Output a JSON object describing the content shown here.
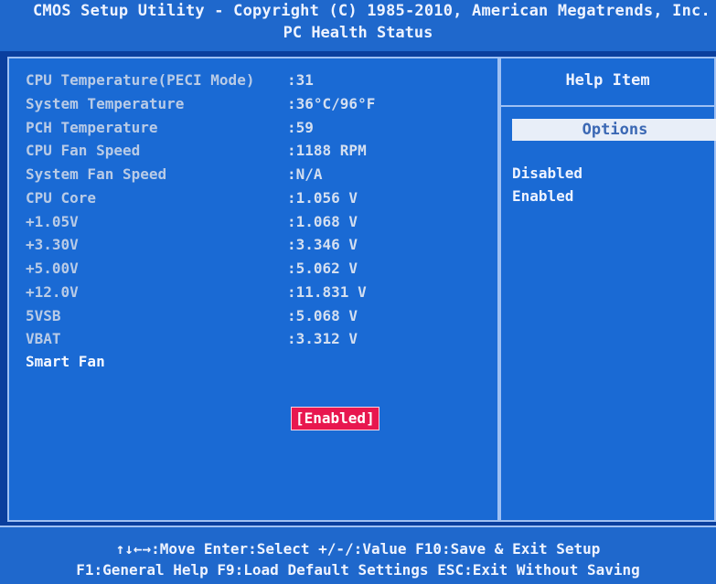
{
  "header": {
    "title": "CMOS Setup Utility - Copyright (C) 1985-2010, American Megatrends, Inc.",
    "subtitle": "PC Health Status"
  },
  "items": [
    {
      "label": "CPU Temperature(PECI Mode)",
      "value": ":31"
    },
    {
      "label": "System Temperature",
      "value": ":36°C/96°F"
    },
    {
      "label": "PCH Temperature",
      "value": ":59"
    },
    {
      "label": "CPU Fan Speed",
      "value": ":1188 RPM"
    },
    {
      "label": "System Fan Speed",
      "value": ":N/A"
    },
    {
      "label": "CPU Core",
      "value": ":1.056 V"
    },
    {
      "label": "+1.05V",
      "value": ":1.068 V"
    },
    {
      "label": "+3.30V",
      "value": ":3.346 V"
    },
    {
      "label": "+5.00V",
      "value": ":5.062 V"
    },
    {
      "label": "+12.0V",
      "value": ":11.831 V"
    },
    {
      "label": "5VSB",
      "value": ":5.068 V"
    },
    {
      "label": "VBAT",
      "value": ":3.312 V"
    }
  ],
  "smart_fan": {
    "label": "Smart Fan",
    "value": "[Enabled]"
  },
  "help": {
    "title": "Help Item",
    "options_label": "Options",
    "options": [
      "Disabled",
      "Enabled"
    ]
  },
  "footer": {
    "line1": "↑↓←→:Move  Enter:Select  +/-/:Value  F10:Save & Exit Setup",
    "line2": "F1:General Help  F9:Load Default Settings  ESC:Exit Without Saving"
  },
  "colors": {
    "background": "#0a3f9e",
    "panel": "#1a6ad4",
    "header": "#1f68cc",
    "selection": "#e8174f"
  }
}
